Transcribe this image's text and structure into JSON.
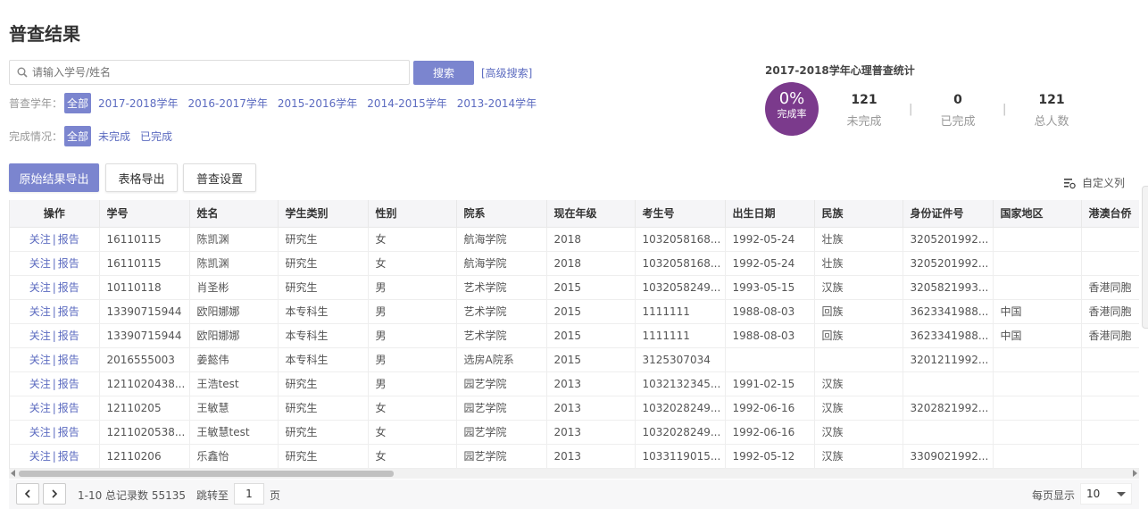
{
  "page_title": "普查结果",
  "search": {
    "placeholder": "请输入学号/姓名",
    "button_label": "搜索",
    "advanced_label": "[高级搜索]"
  },
  "filters": {
    "year": {
      "label": "普查学年：",
      "options": [
        "全部",
        "2017-2018学年",
        "2016-2017学年",
        "2015-2016学年",
        "2014-2015学年",
        "2013-2014学年"
      ]
    },
    "status": {
      "label": "完成情况：",
      "options": [
        "全部",
        "未完成",
        "已完成"
      ]
    }
  },
  "stats": {
    "title": "2017-2018学年心理普查统计",
    "completion_pct": "0%",
    "completion_label": "完成率",
    "items": [
      {
        "value": "121",
        "label": "未完成"
      },
      {
        "value": "0",
        "label": "已完成"
      },
      {
        "value": "121",
        "label": "总人数"
      }
    ],
    "separator": "|",
    "circle_color": "#7b3a8c"
  },
  "actions": {
    "export_raw": "原始结果导出",
    "export_table": "表格导出",
    "settings": "普查设置",
    "custom_columns": "自定义列"
  },
  "table": {
    "columns": [
      "操作",
      "学号",
      "姓名",
      "学生类别",
      "性别",
      "院系",
      "现在年级",
      "考生号",
      "出生日期",
      "民族",
      "身份证件号",
      "国家地区",
      "港澳台侨"
    ],
    "action_follow": "关注",
    "action_sep": "|",
    "action_report": "报告",
    "rows": [
      [
        "16110115",
        "陈凯渊",
        "研究生",
        "女",
        "航海学院",
        "2018",
        "1032058168...",
        "1992-05-24",
        "壮族",
        "3205201992...",
        "",
        ""
      ],
      [
        "16110115",
        "陈凯渊",
        "研究生",
        "女",
        "航海学院",
        "2018",
        "1032058168...",
        "1992-05-24",
        "壮族",
        "3205201992...",
        "",
        ""
      ],
      [
        "10110118",
        "肖圣彬",
        "研究生",
        "男",
        "艺术学院",
        "2015",
        "1032058249...",
        "1993-05-15",
        "汉族",
        "3205821993...",
        "",
        "香港同胞"
      ],
      [
        "13390715944",
        "欧阳娜娜",
        "本专科生",
        "男",
        "艺术学院",
        "2015",
        "1111111",
        "1988-08-03",
        "回族",
        "3623341988...",
        "中国",
        "香港同胞"
      ],
      [
        "13390715944",
        "欧阳娜娜",
        "本专科生",
        "男",
        "艺术学院",
        "2015",
        "1111111",
        "1988-08-03",
        "回族",
        "3623341988...",
        "中国",
        "香港同胞"
      ],
      [
        "2016555003",
        "姜懿伟",
        "本专科生",
        "男",
        "选房A院系",
        "2015",
        "3125307034",
        "",
        "",
        "3201211992...",
        "",
        ""
      ],
      [
        "1211020438...",
        "王浩test",
        "研究生",
        "男",
        "园艺学院",
        "2013",
        "1032132345...",
        "1991-02-15",
        "汉族",
        "",
        "",
        ""
      ],
      [
        "12110205",
        "王敏慧",
        "研究生",
        "女",
        "园艺学院",
        "2013",
        "1032028249...",
        "1992-06-16",
        "汉族",
        "3202821992...",
        "",
        ""
      ],
      [
        "1211020538...",
        "王敏慧test",
        "研究生",
        "女",
        "园艺学院",
        "2013",
        "1032028249...",
        "1992-06-16",
        "汉族",
        "",
        "",
        ""
      ],
      [
        "12110206",
        "乐鑫怡",
        "研究生",
        "女",
        "园艺学院",
        "2013",
        "1033119015...",
        "1992-05-12",
        "汉族",
        "3309021992...",
        "",
        ""
      ]
    ]
  },
  "pagination": {
    "summary": "1-10 总记录数 55135",
    "jump_label": "跳转至",
    "jump_value": "1",
    "page_suffix": "页",
    "per_page_label": "每页显示",
    "per_page_value": "10"
  },
  "colors": {
    "accent": "#7b85cf",
    "link": "#5c6bc0"
  }
}
